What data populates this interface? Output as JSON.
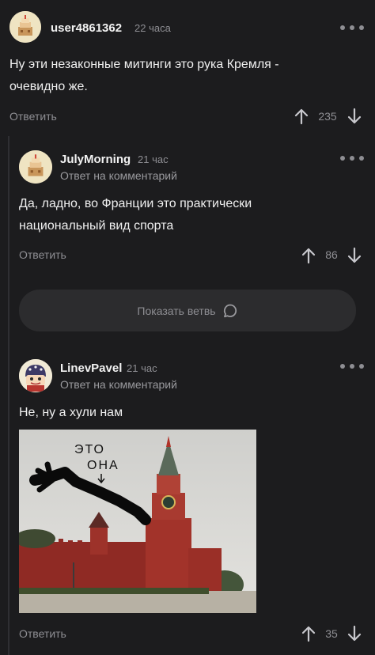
{
  "comments": [
    {
      "username": "user4861362",
      "time": "22 часа",
      "text_lines": [
        "Ну эти незаконные митинги это рука Кремля -",
        "очевидно же."
      ],
      "reply_label": "Ответить",
      "score": "235"
    },
    {
      "username": "JulyMorning",
      "time": "21 час",
      "subtitle": "Ответ на комментарий",
      "text_lines": [
        "Да, ладно, во Франции это практически",
        "национальный вид спорта"
      ],
      "reply_label": "Ответить",
      "score": "86"
    },
    {
      "username": "LinevPavel",
      "time": "21 час",
      "subtitle": "Ответ на комментарий",
      "text_lines": [
        "Не, ну а хули нам"
      ],
      "image_caption": [
        "ЭТО",
        "ОНА"
      ],
      "reply_label": "Ответить",
      "score": "35"
    }
  ],
  "show_branch": {
    "label": "Показать ветвь",
    "icon": "speech-bubble-icon"
  },
  "icons": {
    "more": "more-dots-icon",
    "upvote": "arrow-up-icon",
    "downvote": "arrow-down-icon"
  },
  "colors": {
    "background": "#1c1c1e",
    "button": "#2c2c2e",
    "muted": "#8e8e93",
    "text": "#f0f0f0"
  }
}
